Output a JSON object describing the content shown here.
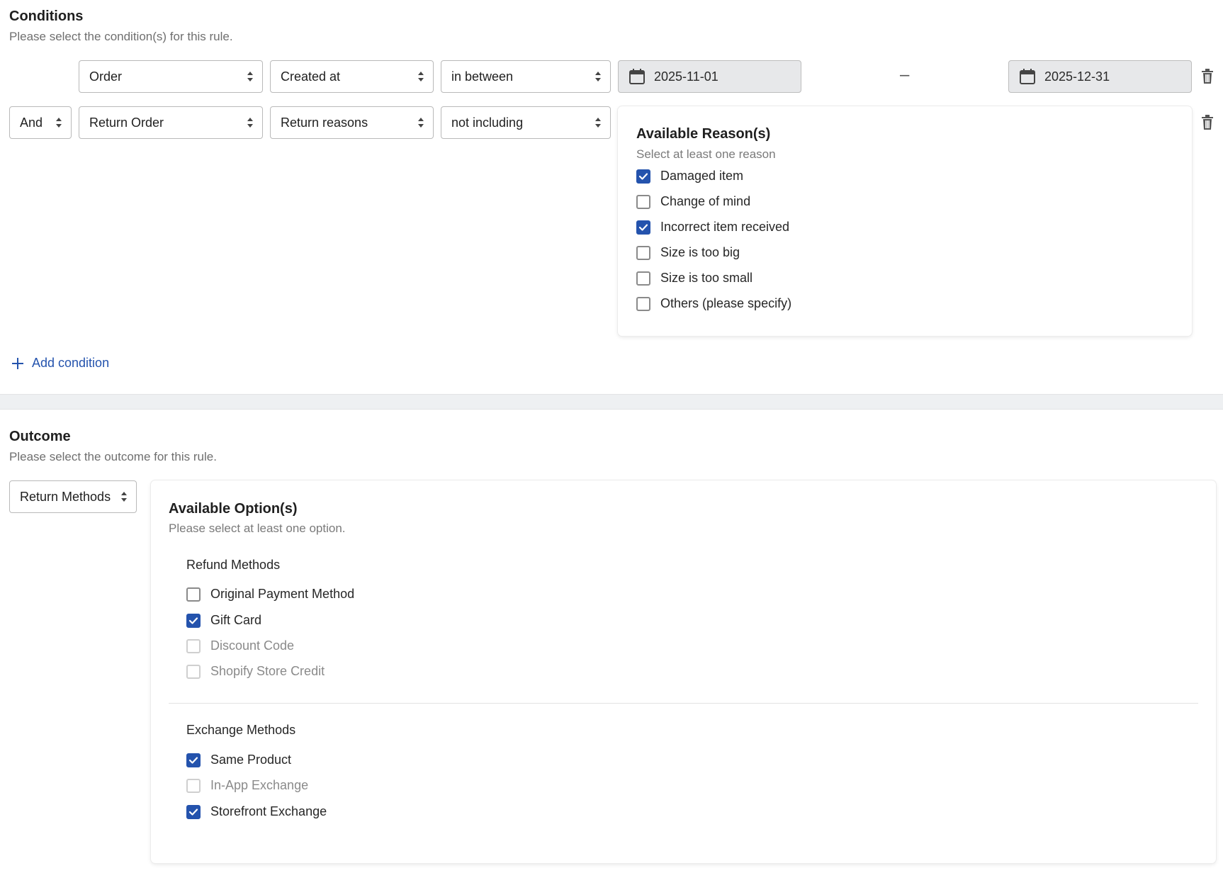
{
  "conditions": {
    "title": "Conditions",
    "subtitle": "Please select the condition(s) for this rule.",
    "row1": {
      "object": "Order",
      "field": "Created at",
      "operator": "in between",
      "date_from": "2025-11-01",
      "date_separator": "–",
      "date_to": "2025-12-31"
    },
    "row2": {
      "conjunction": "And",
      "object": "Return Order",
      "field": "Return reasons",
      "operator": "not including"
    },
    "reasons_panel": {
      "title": "Available Reason(s)",
      "subtitle": "Select at least one reason",
      "items": [
        {
          "label": "Damaged item",
          "checked": true
        },
        {
          "label": "Change of mind",
          "checked": false
        },
        {
          "label": "Incorrect item received",
          "checked": true
        },
        {
          "label": "Size is too big",
          "checked": false
        },
        {
          "label": "Size is too small",
          "checked": false
        },
        {
          "label": "Others (please specify)",
          "checked": false
        }
      ]
    },
    "add_condition_label": "Add condition"
  },
  "outcome": {
    "title": "Outcome",
    "subtitle": "Please select the outcome for this rule.",
    "type": "Return Methods",
    "options_panel": {
      "title": "Available Option(s)",
      "subtitle": "Please select at least one option.",
      "refund": {
        "label": "Refund Methods",
        "items": [
          {
            "label": "Original Payment Method",
            "checked": false,
            "disabled": false
          },
          {
            "label": "Gift Card",
            "checked": true,
            "disabled": false
          },
          {
            "label": "Discount Code",
            "checked": false,
            "disabled": true
          },
          {
            "label": "Shopify Store Credit",
            "checked": false,
            "disabled": true
          }
        ]
      },
      "exchange": {
        "label": "Exchange Methods",
        "items": [
          {
            "label": "Same Product",
            "checked": true,
            "disabled": false
          },
          {
            "label": "In-App Exchange",
            "checked": false,
            "disabled": true
          },
          {
            "label": "Storefront Exchange",
            "checked": true,
            "disabled": false
          }
        ]
      }
    }
  },
  "colors": {
    "accent": "#2453ad",
    "date_bg": "#e7e8ea",
    "band": "#eef0f2"
  }
}
